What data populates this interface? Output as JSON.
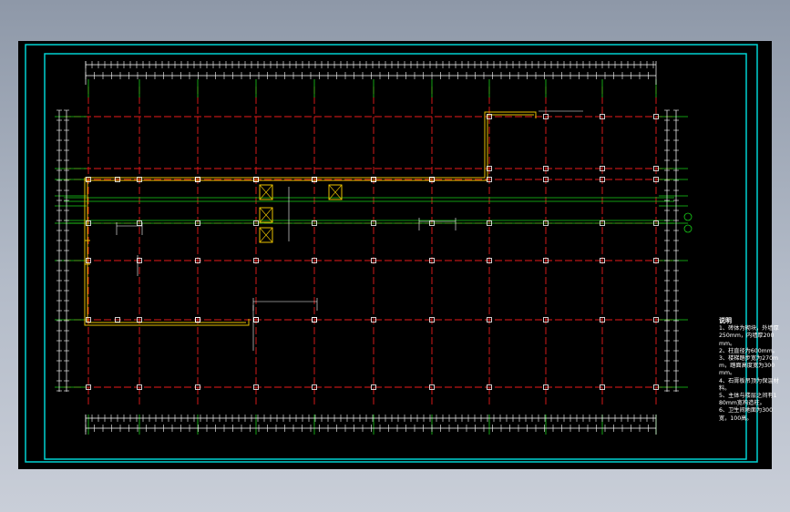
{
  "colors": {
    "background": "#000000",
    "frame": "#00d2d2",
    "axis_line": "#e81a1a",
    "grid_green": "#18d018",
    "wall": "#e8c000",
    "dim_white": "#ffffff"
  },
  "notes": {
    "title": "说明",
    "items": [
      "1、砖体为砌块，外墙厚250mm，内墙厚200mm。",
      "2、柱直径为600mm。",
      "3、楼梯踏步宽为270mm，踏面高度宽为300mm。",
      "4、石膏板吊顶为保温材料。",
      "5、主体与楼层之间有180mm宽构造柱。",
      "6、卫生间地面为300宽，100高。"
    ]
  },
  "axis_bubbles": [
    "③",
    "④"
  ],
  "elevator_icons": [
    "elevator-symbol",
    "stair-symbol"
  ]
}
